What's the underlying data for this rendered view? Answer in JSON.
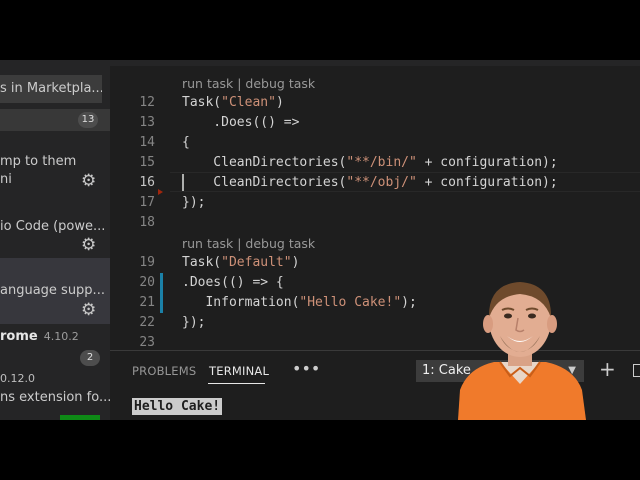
{
  "sidebar": {
    "search_text": "s in Marketpla...",
    "installed_count": "13",
    "extensions": [
      {
        "line1": "mp to them",
        "line2": "ni"
      },
      {
        "line1": "io Code (powe..."
      },
      {
        "line1": "anguage supp..."
      },
      {
        "name": "rome",
        "version": "4.10.2",
        "count": "2",
        "line2": "0.12.0",
        "line3": "ns extension fo..."
      }
    ]
  },
  "editor": {
    "codelens": [
      "run task | debug task",
      "run task | debug task"
    ],
    "lines": [
      {
        "num": "12",
        "text": "Task(\"Clean\")"
      },
      {
        "num": "13",
        "text": "    .Does(() =>"
      },
      {
        "num": "14",
        "text": "{"
      },
      {
        "num": "15",
        "text": "    CleanDirectories(\"**/bin/\" + configuration);"
      },
      {
        "num": "16",
        "text": "    CleanDirectories(\"**/obj/\" + configuration);"
      },
      {
        "num": "17",
        "text": "});"
      },
      {
        "num": "18",
        "text": ""
      },
      {
        "num": "19",
        "text": "Task(\"Default\")"
      },
      {
        "num": "20",
        "text": ".Does(() => {"
      },
      {
        "num": "21",
        "text": "   Information(\"Hello Cake!\");"
      },
      {
        "num": "22",
        "text": "});"
      },
      {
        "num": "23",
        "text": ""
      }
    ]
  },
  "panel": {
    "tabs": [
      "PROBLEMS",
      "TERMINAL"
    ],
    "more": "•••",
    "terminal_selected": "1: Cake",
    "terminal_output": "Hello Cake!"
  },
  "icons": {
    "gear": "gear-icon",
    "plus": "plus-icon",
    "split": "split-terminal-icon",
    "more": "more-actions-icon",
    "chevron": "chevron-down-icon"
  },
  "colors": {
    "editor_bg": "#1e1e1e",
    "sidebar_bg": "#252526",
    "string": "#ce9178",
    "text": "#d4d4d4",
    "modified_gutter": "#1b81a8",
    "webcam_shirt": "#f07a2b"
  }
}
